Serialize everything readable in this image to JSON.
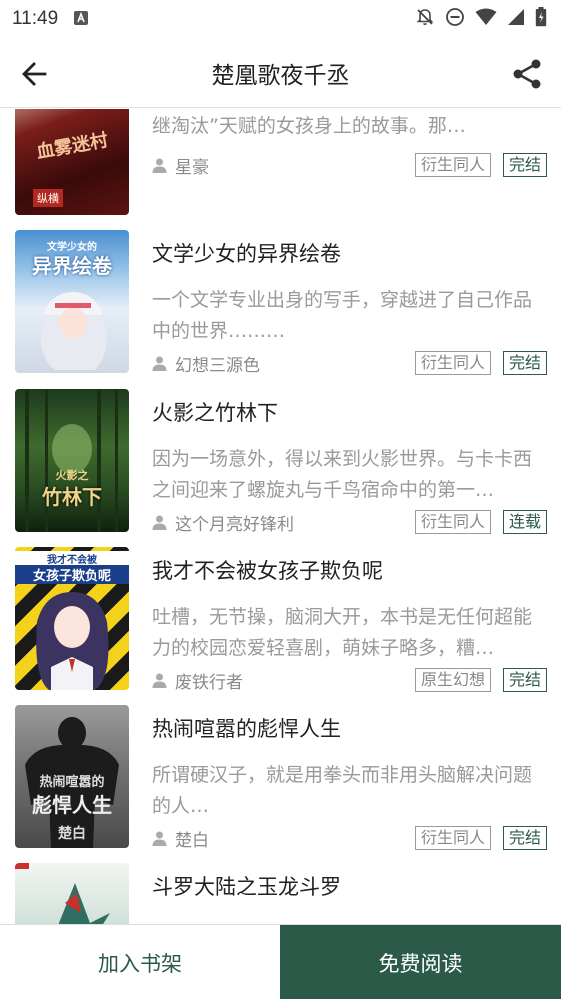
{
  "status_bar": {
    "time": "11:49"
  },
  "header": {
    "title": "楚凰歌夜千丞"
  },
  "books": [
    {
      "title": "",
      "description": "这是一个都市之人，重生到血雾之村，拥有“血继淘汰”天赋的女孩身上的故事。那…",
      "author": "星豪",
      "genre": "衍生同人",
      "status": "完结",
      "cover_text": "血雾迷村",
      "cover_publisher": "纵横"
    },
    {
      "title": "文学少女的异界绘卷",
      "description": "一个文学专业出身的写手，穿越进了自己作品中的世界………",
      "author": "幻想三源色",
      "genre": "衍生同人",
      "status": "完结",
      "cover_text": "异界绘卷",
      "cover_subtitle": "文学少女的"
    },
    {
      "title": "火影之竹林下",
      "description": "因为一场意外，得以来到火影世界。与卡卡西之间迎来了螺旋丸与千鸟宿命中的第一…",
      "author": "这个月亮好锋利",
      "genre": "衍生同人",
      "status": "连载",
      "cover_text": "竹林下",
      "cover_subtitle": "火影之"
    },
    {
      "title": "我才不会被女孩子欺负呢",
      "description": "吐槽，无节操，脑洞大开，本书是无任何超能力的校园恋爱轻喜剧，萌妹子略多，糟…",
      "author": "废铁行者",
      "genre": "原生幻想",
      "status": "完结",
      "cover_text": "女孩子欺负呢",
      "cover_subtitle": "我才不会被"
    },
    {
      "title": "热闹喧嚣的彪悍人生",
      "description": "所谓硬汉子，就是用拳头而非用头脑解决问题的人…",
      "author": "楚白",
      "genre": "衍生同人",
      "status": "完结",
      "cover_text": "彪悍人生",
      "cover_subtitle": "热闹喧嚣的",
      "cover_author": "楚白"
    },
    {
      "title": "斗罗大陆之玉龙斗罗",
      "description": "",
      "author": "",
      "genre": "",
      "status": ""
    }
  ],
  "actions": {
    "add_shelf": "加入书架",
    "read_free": "免费阅读"
  },
  "colors": {
    "accent": "#2b5a48",
    "desc": "#9a9a9a"
  }
}
